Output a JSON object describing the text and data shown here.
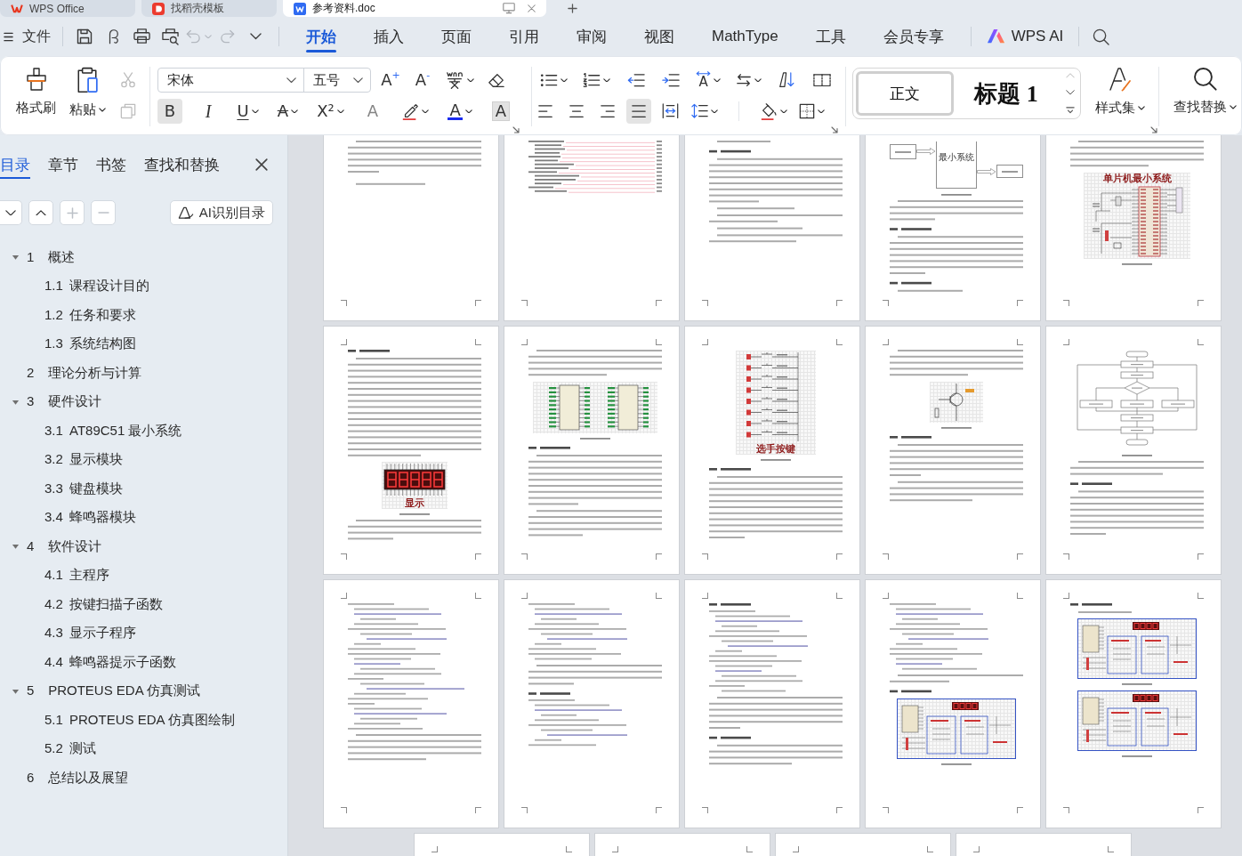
{
  "window_tabs": [
    {
      "kind": "wps",
      "label": "WPS Office",
      "selected": false
    },
    {
      "kind": "template",
      "label": "找稻壳模板",
      "selected": false
    },
    {
      "kind": "writer",
      "label": "参考资料.doc",
      "selected": true
    }
  ],
  "menu_bar": {
    "file_label": "文件",
    "quick_access": [
      {
        "kind": "save",
        "disabled": false,
        "menu": false
      },
      {
        "kind": "curl",
        "disabled": false,
        "menu": false
      },
      {
        "kind": "print",
        "disabled": false,
        "menu": false
      },
      {
        "kind": "preview",
        "disabled": false,
        "menu": false
      },
      {
        "kind": "undo",
        "disabled": true,
        "menu": true
      },
      {
        "kind": "redo",
        "disabled": true,
        "menu": false
      },
      {
        "kind": "more",
        "disabled": false,
        "menu": false
      }
    ],
    "tabs": [
      {
        "label": "开始",
        "selected": true
      },
      {
        "label": "插入",
        "selected": false
      },
      {
        "label": "页面",
        "selected": false
      },
      {
        "label": "引用",
        "selected": false
      },
      {
        "label": "审阅",
        "selected": false
      },
      {
        "label": "视图",
        "selected": false
      },
      {
        "label": "MathType",
        "selected": false
      },
      {
        "label": "工具",
        "selected": false
      },
      {
        "label": "会员专享",
        "selected": false
      }
    ],
    "ai_label": "WPS AI"
  },
  "ribbon": {
    "clipboard": {
      "large": [
        {
          "kind": "format-painter",
          "label": "格式刷",
          "menu": false
        },
        {
          "kind": "paste",
          "label": "粘贴",
          "menu": true
        }
      ],
      "small": [
        {
          "kind": "cut",
          "disabled": true
        },
        {
          "kind": "copy",
          "disabled": true
        }
      ]
    },
    "font": {
      "name": "宋体",
      "size": "五号",
      "row_1": [
        {
          "kind": "grow",
          "glyph": "A$^{+}$",
          "menu": false
        },
        {
          "kind": "shrink",
          "glyph": "A$^{-}$",
          "menu": false
        },
        {
          "kind": "pinyin",
          "menu": true
        },
        {
          "kind": "clear",
          "menu": false
        }
      ],
      "row_2": [
        {
          "kind": "bold",
          "glyph": "B",
          "menu": false,
          "selected": true,
          "disabled": false
        },
        {
          "kind": "italic",
          "glyph": "I",
          "menu": false,
          "selected": false,
          "disabled": false
        },
        {
          "kind": "underline",
          "glyph": "U",
          "menu": true,
          "selected": false,
          "disabled": false
        },
        {
          "kind": "strikethrough",
          "glyph": "A",
          "menu": true,
          "selected": false,
          "disabled": false
        },
        {
          "kind": "superscript",
          "glyph": "X²",
          "menu": true,
          "selected": false,
          "disabled": false
        },
        {
          "kind": "effect",
          "glyph": "A",
          "menu": false,
          "selected": false,
          "disabled": true
        },
        {
          "kind": "highlight",
          "menu": true,
          "selected": false,
          "disabled": false
        },
        {
          "kind": "color",
          "glyph": "A",
          "menu": true,
          "selected": false,
          "disabled": false
        },
        {
          "kind": "shading",
          "glyph": "A",
          "menu": false,
          "selected": false,
          "disabled": false
        }
      ]
    },
    "paragraph": {
      "row_1": [
        {
          "kind": "bullets",
          "menu": true
        },
        {
          "kind": "numbering",
          "menu": true
        },
        {
          "kind": "outdent",
          "menu": false
        },
        {
          "kind": "indent",
          "menu": false
        },
        {
          "kind": "direction",
          "glyph": "A",
          "menu": true
        },
        {
          "kind": "swap",
          "menu": true
        },
        {
          "kind": "sort",
          "menu": false
        },
        {
          "kind": "frame",
          "menu": false
        }
      ],
      "row_2": [
        {
          "kind": "left",
          "menu": false,
          "selected": false
        },
        {
          "kind": "center",
          "menu": false,
          "selected": false
        },
        {
          "kind": "right",
          "menu": false,
          "selected": false
        },
        {
          "kind": "justify",
          "menu": false,
          "selected": true
        },
        {
          "kind": "distributed",
          "menu": false,
          "selected": false
        },
        {
          "kind": "spacing",
          "menu": true,
          "selected": false
        },
        {
          "kind": "shading-fill",
          "menu": true,
          "selected": false
        },
        {
          "kind": "borders",
          "menu": true,
          "selected": false
        }
      ]
    },
    "styles": [
      {
        "kind": "body",
        "label": "正文",
        "selected": true
      },
      {
        "kind": "heading",
        "label": "标题 1",
        "selected": false
      }
    ],
    "style_set": {
      "label": "样式集",
      "menu": true
    },
    "find_replace": {
      "label": "查找替换",
      "menu": true
    }
  },
  "sidebar": {
    "tabs": [
      {
        "label": "目录",
        "selected": true
      },
      {
        "label": "章节",
        "selected": false
      },
      {
        "label": "书签",
        "selected": false
      },
      {
        "label": "查找和替换",
        "selected": false
      }
    ],
    "tools": [
      {
        "kind": "expand",
        "disabled": false
      },
      {
        "kind": "collapse",
        "disabled": false
      },
      {
        "kind": "add",
        "disabled": true
      },
      {
        "kind": "remove",
        "disabled": true
      }
    ],
    "ai_button": "AI识别目录",
    "outline": [
      {
        "number": "1",
        "title": "概述",
        "expanded": true,
        "children": [
          {
            "number": "1.1",
            "title": "课程设计目的"
          },
          {
            "number": "1.2",
            "title": "任务和要求"
          },
          {
            "number": "1.3",
            "title": "系统结构图"
          }
        ]
      },
      {
        "number": "2",
        "title": "理论分析与计算"
      },
      {
        "number": "3",
        "title": "硬件设计",
        "expanded": true,
        "children": [
          {
            "number": "3.1",
            "title": "AT89C51 最小系统"
          },
          {
            "number": "3.2",
            "title": "显示模块"
          },
          {
            "number": "3.3",
            "title": "键盘模块"
          },
          {
            "number": "3.4",
            "title": "蜂鸣器模块"
          }
        ]
      },
      {
        "number": "4",
        "title": "软件设计",
        "expanded": true,
        "children": [
          {
            "number": "4.1",
            "title": "主程序"
          },
          {
            "number": "4.2",
            "title": "按键扫描子函数"
          },
          {
            "number": "4.3",
            "title": "显示子程序"
          },
          {
            "number": "4.4",
            "title": "蜂鸣器提示子函数"
          }
        ]
      },
      {
        "number": "5",
        "title": "PROTEUS EDA 仿真测试",
        "expanded": true,
        "children": [
          {
            "number": "5.1",
            "title": "PROTEUS EDA 仿真图绘制"
          },
          {
            "number": "5.2",
            "title": "测试"
          }
        ]
      },
      {
        "number": "6",
        "title": "总结以及展望"
      }
    ]
  },
  "page_rows": [
    [
      {
        "kind": "abstract"
      },
      {
        "kind": "contents"
      },
      {
        "kind": "text"
      },
      {
        "kind": "block-diagram",
        "caption": "最小系统"
      },
      {
        "kind": "schematic",
        "caption": "单片机最小系统"
      }
    ],
    [
      {
        "kind": "display",
        "caption": "显示"
      },
      {
        "kind": "chips"
      },
      {
        "kind": "keys",
        "caption": "选手按键"
      },
      {
        "kind": "circuit"
      },
      {
        "kind": "flowchart"
      }
    ],
    [
      {
        "kind": "code"
      },
      {
        "kind": "code-text"
      },
      {
        "kind": "code-sections"
      },
      {
        "kind": "code-figure"
      },
      {
        "kind": "figures"
      }
    ],
    [
      {
        "kind": "blank"
      },
      {
        "kind": "blank"
      },
      {
        "kind": "blank"
      },
      {
        "kind": "blank"
      }
    ]
  ]
}
